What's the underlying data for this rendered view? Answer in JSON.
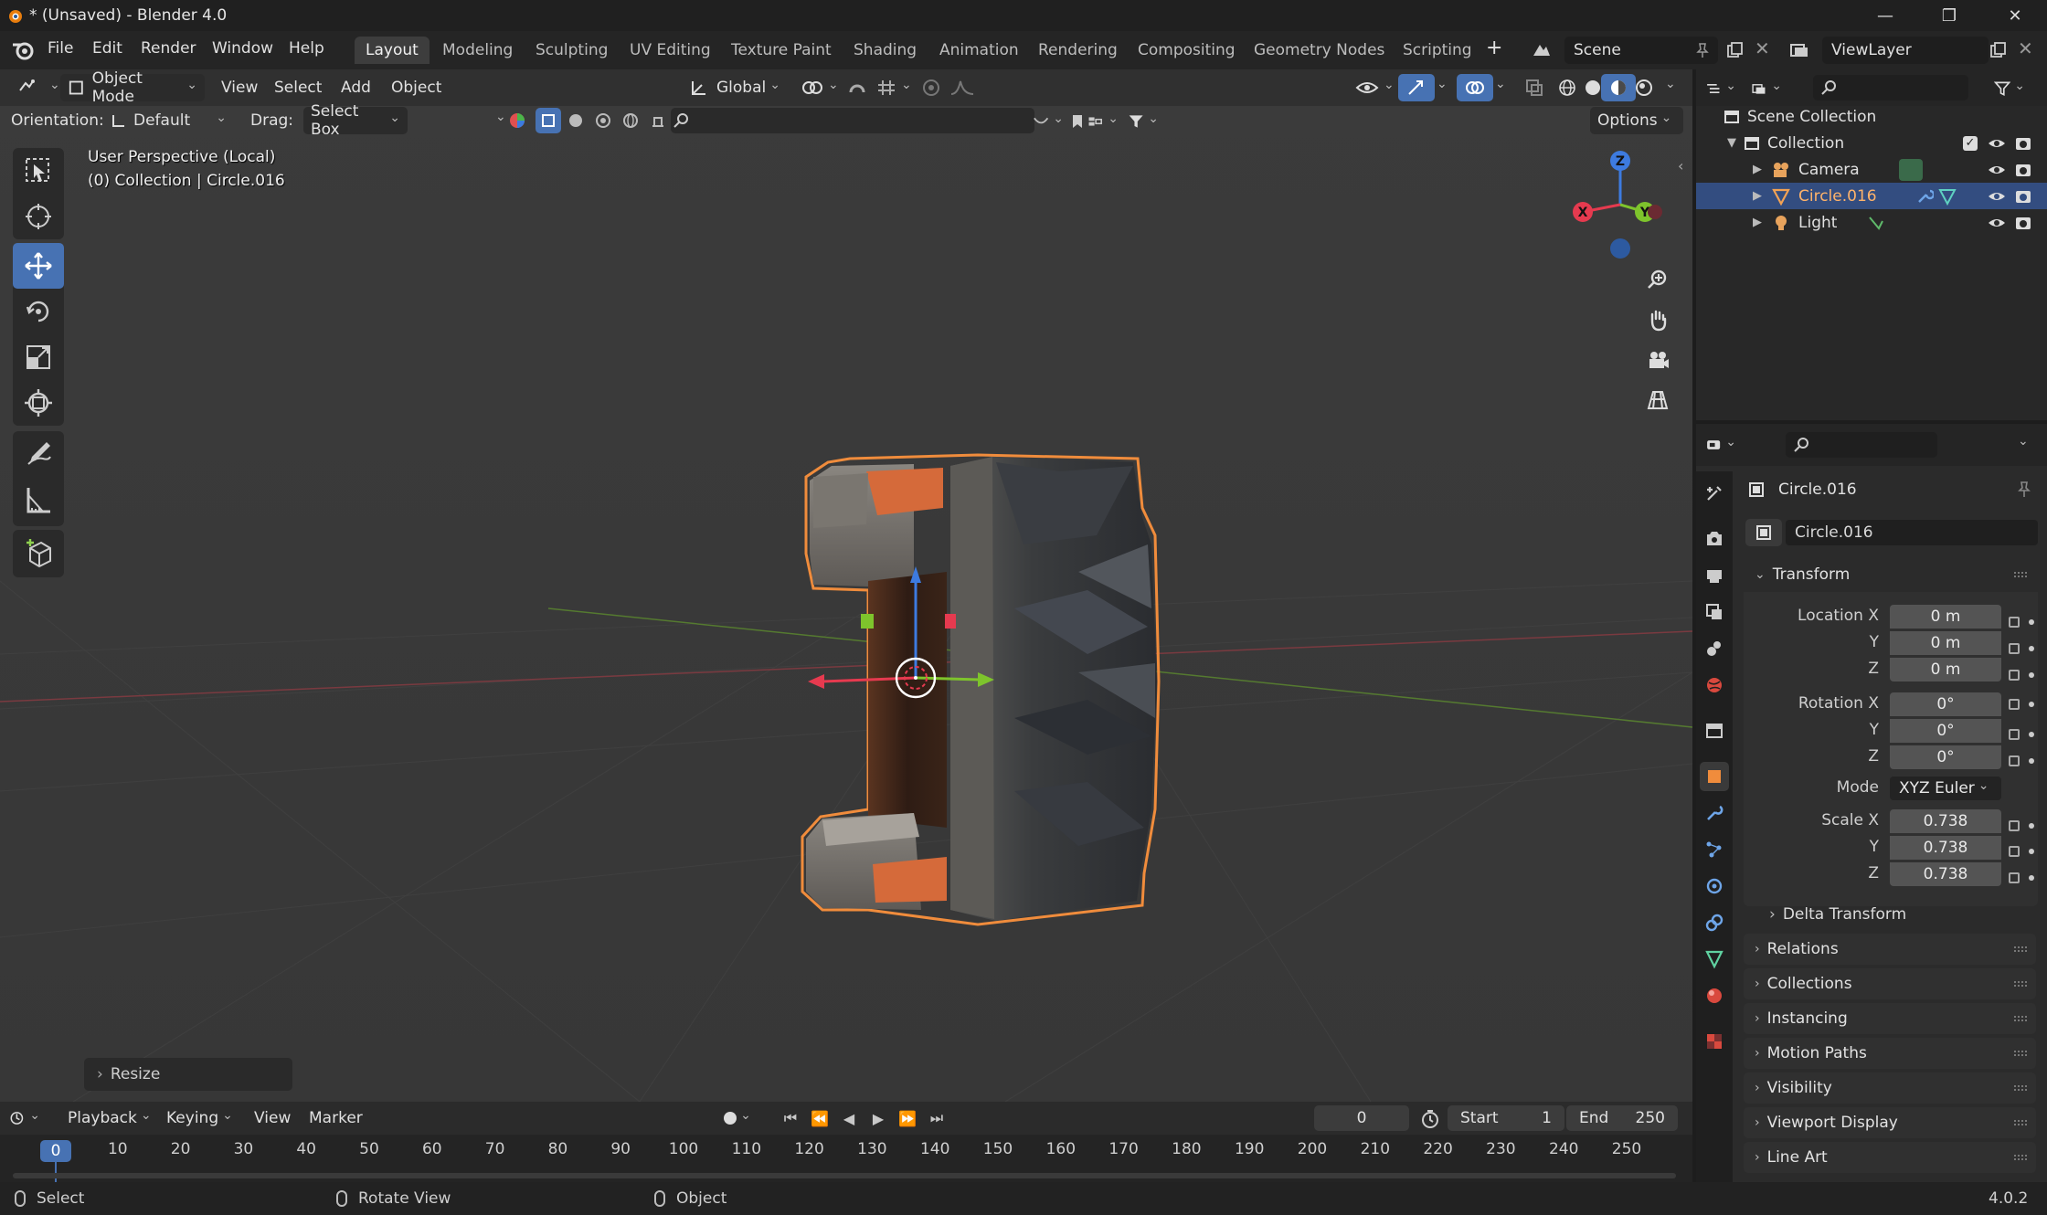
{
  "window": {
    "title": "* (Unsaved) - Blender 4.0",
    "controls": [
      "—",
      "❐",
      "✕"
    ]
  },
  "menu": [
    "File",
    "Edit",
    "Render",
    "Window",
    "Help"
  ],
  "workspaces": [
    "Layout",
    "Modeling",
    "Sculpting",
    "UV Editing",
    "Texture Paint",
    "Shading",
    "Animation",
    "Rendering",
    "Compositing",
    "Geometry Nodes",
    "Scripting"
  ],
  "active_workspace": "Layout",
  "scene": {
    "name": "Scene",
    "view_layer": "ViewLayer"
  },
  "viewport_header": {
    "mode": "Object Mode",
    "menus": [
      "View",
      "Select",
      "Add",
      "Object"
    ],
    "transform_orientation": "Global",
    "orientation_label": "Orientation:",
    "orientation_value": "Default",
    "drag_label": "Drag:",
    "drag_value": "Select Box",
    "options": "Options"
  },
  "viewport_overlay": {
    "view_name": "User Perspective (Local)",
    "context": "(0) Collection | Circle.016",
    "last_operator": "Resize"
  },
  "gizmo": {
    "z": "Z",
    "x": "X",
    "y": "Y"
  },
  "outliner": {
    "root": "Scene Collection",
    "collection": "Collection",
    "items": [
      {
        "name": "Camera",
        "type": "camera"
      },
      {
        "name": "Circle.016",
        "type": "mesh",
        "selected": true
      },
      {
        "name": "Light",
        "type": "light"
      }
    ]
  },
  "properties": {
    "object_name": "Circle.016",
    "datablock": "Circle.016",
    "transform_title": "Transform",
    "location_label": "Location X",
    "location": [
      "0 m",
      "0 m",
      "0 m"
    ],
    "rotation_label": "Rotation X",
    "rotation": [
      "0°",
      "0°",
      "0°"
    ],
    "mode_label": "Mode",
    "mode": "XYZ Euler",
    "scale_label": "Scale X",
    "scale": [
      "0.738",
      "0.738",
      "0.738"
    ],
    "axis_y": "Y",
    "axis_z": "Z",
    "delta": "Delta Transform",
    "panels": [
      "Relations",
      "Collections",
      "Instancing",
      "Motion Paths",
      "Visibility",
      "Viewport Display",
      "Line Art"
    ]
  },
  "timeline": {
    "menus": [
      "Playback",
      "Keying",
      "View",
      "Marker"
    ],
    "current_frame": "0",
    "start_label": "Start",
    "start": "1",
    "end_label": "End",
    "end": "250",
    "ticks": [
      "0",
      "10",
      "20",
      "30",
      "40",
      "50",
      "60",
      "70",
      "80",
      "90",
      "100",
      "110",
      "120",
      "130",
      "140",
      "150",
      "160",
      "170",
      "180",
      "190",
      "200",
      "210",
      "220",
      "230",
      "240",
      "250"
    ]
  },
  "statusbar": {
    "select": "Select",
    "rotate": "Rotate View",
    "object": "Object",
    "version": "4.0.2"
  },
  "colors": {
    "accent": "#4772b3",
    "selection": "#f08c3c",
    "x_axis": "#e63a4f",
    "y_axis": "#7ec42c",
    "z_axis": "#3d7be0"
  }
}
